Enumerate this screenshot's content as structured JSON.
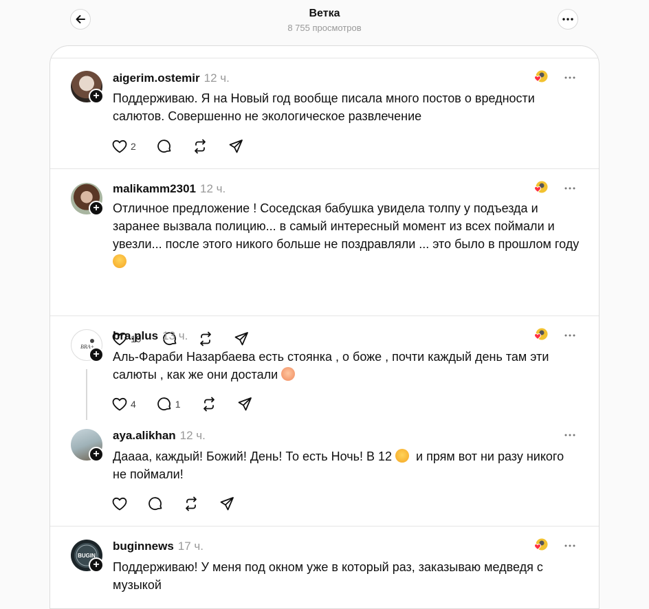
{
  "header": {
    "title": "Ветка",
    "views": "8 755 просмотров",
    "back_icon": "arrow-left-icon",
    "more_icon": "more-horizontal-icon"
  },
  "posts": [
    {
      "username": "aigerim.ostemir",
      "time": "12 ч.",
      "text": "Поддерживаю. Я на Новый год вообще писала много постов о вредности салютов. Совершенно не экологическое развлечение",
      "likes": "2",
      "replies": "",
      "liked_by_author": true
    },
    {
      "username": "malikamm2301",
      "time": "12 ч.",
      "text_before": "Отличное предложение ! Соседская бабушка увидела толпу у подъезда и заранее вызвала полицию... в самый интересный момент из всех поймали и увезли... после этого никого больше не поздравляли ... это было в прошлом году",
      "likes": "19",
      "replies": "",
      "liked_by_author": true
    },
    {
      "username": "bra.plus",
      "time": "13 ч.",
      "text_before": "Аль-Фараби Назарбаева есть стоянка , о боже , почти каждый день там эти салюты , как же они достали",
      "likes": "4",
      "replies": "1",
      "liked_by_author": true
    },
    {
      "username": "aya.alikhan",
      "time": "12 ч.",
      "text_before": "Даааа, каждый! Божий! День! То есть Ночь! В 12",
      "text_after": "и прям вот ни разу никого не поймали!",
      "likes": "",
      "replies": "",
      "liked_by_author": false
    },
    {
      "username": "buginnews",
      "time": "17 ч.",
      "text": "Поддерживаю! У меня под окном уже в который раз, заказываю медведя с музыкой",
      "likes": "",
      "replies": "",
      "liked_by_author": true
    }
  ],
  "colors": {
    "accent_heart": "#ff3040",
    "text": "#101010",
    "muted": "#999999"
  }
}
